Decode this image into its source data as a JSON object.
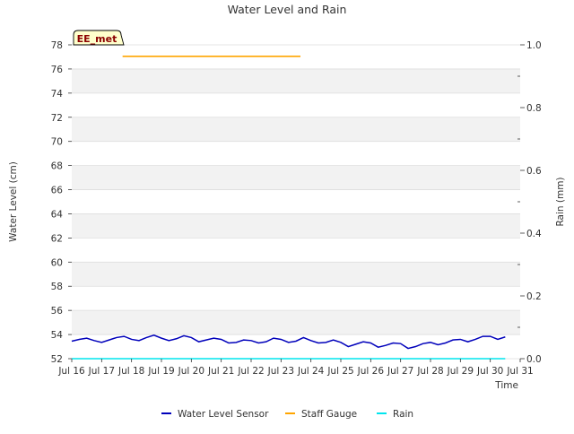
{
  "chart_data": {
    "type": "line",
    "title": "Water Level and Rain",
    "xlabel": "Time",
    "ylabel": "Water Level (cm)",
    "y2label": "Rain (mm)",
    "station_badge": "EE_met",
    "xlim": [
      16,
      31
    ],
    "ylim": [
      52,
      78
    ],
    "y2lim": [
      0.0,
      1.0
    ],
    "x_ticks": [
      {
        "value": 16,
        "label": "Jul 16"
      },
      {
        "value": 17,
        "label": "Jul 17"
      },
      {
        "value": 18,
        "label": "Jul 18"
      },
      {
        "value": 19,
        "label": "Jul 19"
      },
      {
        "value": 20,
        "label": "Jul 20"
      },
      {
        "value": 21,
        "label": "Jul 21"
      },
      {
        "value": 22,
        "label": "Jul 22"
      },
      {
        "value": 23,
        "label": "Jul 23"
      },
      {
        "value": 24,
        "label": "Jul 24"
      },
      {
        "value": 25,
        "label": "Jul 25"
      },
      {
        "value": 26,
        "label": "Jul 26"
      },
      {
        "value": 27,
        "label": "Jul 27"
      },
      {
        "value": 28,
        "label": "Jul 28"
      },
      {
        "value": 29,
        "label": "Jul 29"
      },
      {
        "value": 30,
        "label": "Jul 30"
      },
      {
        "value": 31,
        "label": "Jul 31"
      }
    ],
    "y_ticks": [
      52,
      54,
      56,
      58,
      60,
      62,
      64,
      66,
      68,
      70,
      72,
      74,
      76,
      78
    ],
    "y2_ticks": [
      "0.0",
      "0.2",
      "0.4",
      "0.6",
      "0.8",
      "1.0"
    ],
    "grid": "horizontal alternating bands",
    "legend_position": "bottom-center",
    "series": [
      {
        "name": "Water Level Sensor",
        "color": "#0000bb",
        "axis": "left",
        "points": [
          [
            16.0,
            53.45
          ],
          [
            16.25,
            53.6
          ],
          [
            16.5,
            53.7
          ],
          [
            16.75,
            53.5
          ],
          [
            17.0,
            53.35
          ],
          [
            17.25,
            53.55
          ],
          [
            17.5,
            53.75
          ],
          [
            17.75,
            53.85
          ],
          [
            18.0,
            53.6
          ],
          [
            18.25,
            53.5
          ],
          [
            18.5,
            53.75
          ],
          [
            18.75,
            53.95
          ],
          [
            19.0,
            53.7
          ],
          [
            19.25,
            53.5
          ],
          [
            19.5,
            53.65
          ],
          [
            19.75,
            53.9
          ],
          [
            20.0,
            53.75
          ],
          [
            20.25,
            53.4
          ],
          [
            20.5,
            53.55
          ],
          [
            20.75,
            53.7
          ],
          [
            21.0,
            53.6
          ],
          [
            21.25,
            53.3
          ],
          [
            21.5,
            53.35
          ],
          [
            21.75,
            53.55
          ],
          [
            22.0,
            53.5
          ],
          [
            22.25,
            53.3
          ],
          [
            22.5,
            53.4
          ],
          [
            22.75,
            53.7
          ],
          [
            23.0,
            53.6
          ],
          [
            23.25,
            53.35
          ],
          [
            23.5,
            53.45
          ],
          [
            23.75,
            53.75
          ],
          [
            24.0,
            53.5
          ],
          [
            24.25,
            53.3
          ],
          [
            24.5,
            53.35
          ],
          [
            24.75,
            53.55
          ],
          [
            25.0,
            53.35
          ],
          [
            25.25,
            53.0
          ],
          [
            25.5,
            53.2
          ],
          [
            25.75,
            53.4
          ],
          [
            26.0,
            53.3
          ],
          [
            26.25,
            52.95
          ],
          [
            26.5,
            53.1
          ],
          [
            26.75,
            53.3
          ],
          [
            27.0,
            53.25
          ],
          [
            27.25,
            52.85
          ],
          [
            27.5,
            53.0
          ],
          [
            27.75,
            53.25
          ],
          [
            28.0,
            53.35
          ],
          [
            28.25,
            53.15
          ],
          [
            28.5,
            53.3
          ],
          [
            28.75,
            53.55
          ],
          [
            29.0,
            53.6
          ],
          [
            29.25,
            53.4
          ],
          [
            29.5,
            53.6
          ],
          [
            29.75,
            53.85
          ],
          [
            30.0,
            53.85
          ],
          [
            30.25,
            53.6
          ],
          [
            30.5,
            53.8
          ]
        ]
      },
      {
        "name": "Staff Gauge",
        "color": "#ffa500",
        "axis": "left",
        "points": [
          [
            17.7,
            77.05
          ],
          [
            23.65,
            77.05
          ]
        ]
      },
      {
        "name": "Rain",
        "color": "#00e5ee",
        "axis": "right",
        "points": [
          [
            16.0,
            0.0
          ],
          [
            30.5,
            0.0
          ]
        ]
      }
    ]
  }
}
